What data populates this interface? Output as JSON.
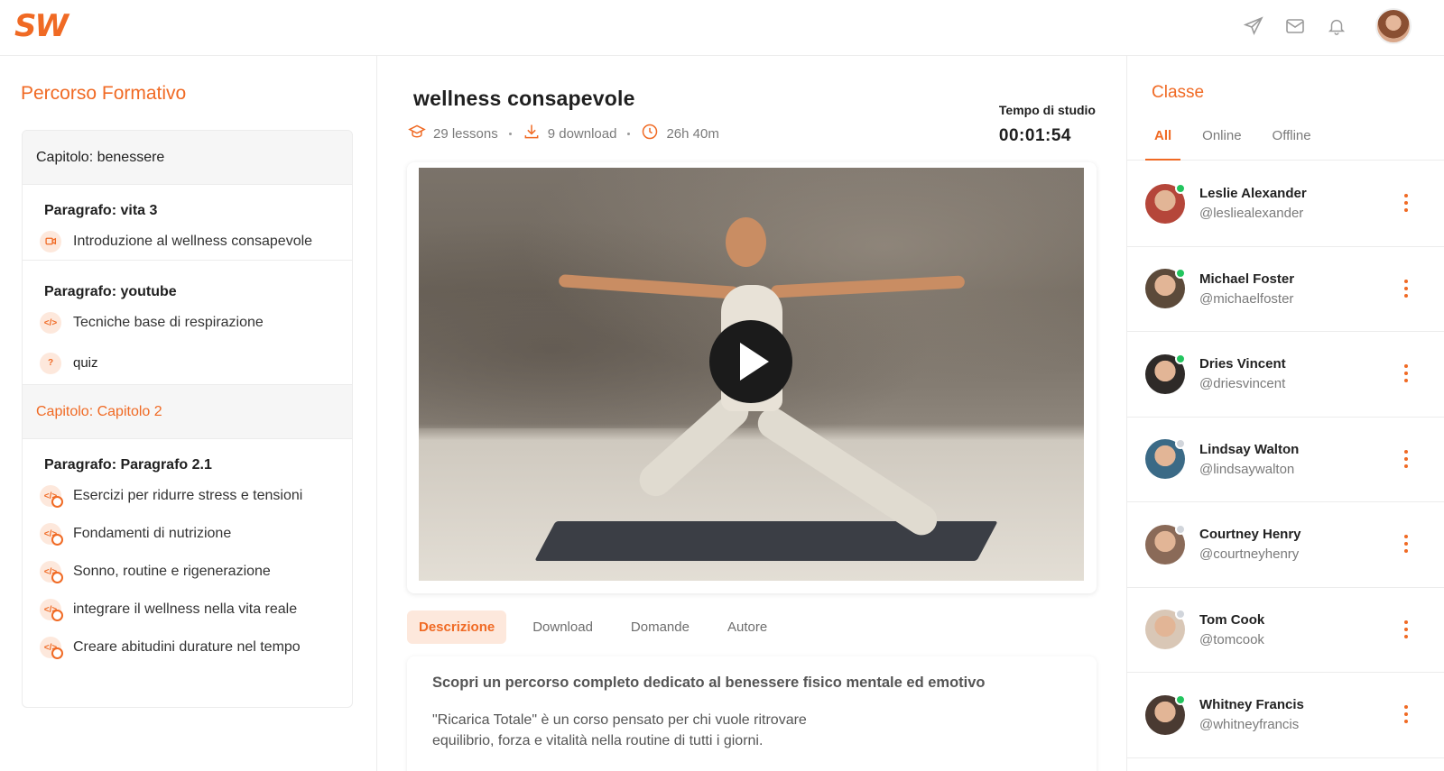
{
  "app": {
    "logo": "SW"
  },
  "header": {
    "icons": [
      "send-icon",
      "mail-icon",
      "bell-icon"
    ],
    "avatar": "user-avatar"
  },
  "sidebar": {
    "title": "Percorso Formativo",
    "chapter1": {
      "label": "Capitolo: benessere",
      "p1": {
        "label": "Paragrafo: vita 3",
        "lessons": [
          {
            "label": "Introduzione al wellness consapevole",
            "icon": "video-icon"
          }
        ]
      },
      "p2": {
        "label": "Paragrafo: youtube",
        "lessons": [
          {
            "label": "Tecniche base di respirazione",
            "icon": "code-icon"
          },
          {
            "label": "quiz",
            "icon": "question-icon"
          }
        ]
      }
    },
    "chapter2": {
      "label": "Capitolo: Capitolo 2",
      "p1": {
        "label": "Paragrafo: Paragrafo 2.1",
        "lessons": [
          {
            "label": "Esercizi per ridurre stress e tensioni"
          },
          {
            "label": "Fondamenti di nutrizione"
          },
          {
            "label": "Sonno, routine e rigenerazione"
          },
          {
            "label": "integrare il wellness nella vita reale"
          },
          {
            "label": "Creare abitudini durature nel tempo"
          }
        ]
      }
    }
  },
  "course": {
    "title": "wellness consapevole",
    "lessons": "29 lessons",
    "downloads": "9 download",
    "duration": "26h 40m",
    "study_label": "Tempo di studio",
    "study_time": "00:01:54"
  },
  "tabs": [
    "Descrizione",
    "Download",
    "Domande",
    "Autore"
  ],
  "description": {
    "heading": "Scopri un percorso completo dedicato al benessere fisico mentale ed emotivo",
    "body": "\"Ricarica Totale\" è un corso pensato per chi vuole ritrovare equilibrio, forza e vitalità nella routine di tutti i giorni."
  },
  "class": {
    "title": "Classe",
    "tabs": [
      "All",
      "Online",
      "Offline"
    ],
    "members": [
      {
        "name": "Leslie Alexander",
        "handle": "@lesliealexander",
        "online": true,
        "color": "#b5463a"
      },
      {
        "name": "Michael Foster",
        "handle": "@michaelfoster",
        "online": true,
        "color": "#5c4a3a"
      },
      {
        "name": "Dries Vincent",
        "handle": "@driesvincent",
        "online": true,
        "color": "#2e2a28"
      },
      {
        "name": "Lindsay Walton",
        "handle": "@lindsaywalton",
        "online": false,
        "color": "#3b6a86"
      },
      {
        "name": "Courtney Henry",
        "handle": "@courtneyhenry",
        "online": false,
        "color": "#8a6a58"
      },
      {
        "name": "Tom Cook",
        "handle": "@tomcook",
        "online": false,
        "color": "#d9c7b6"
      },
      {
        "name": "Whitney Francis",
        "handle": "@whitneyfrancis",
        "online": true,
        "color": "#4a3a32"
      }
    ]
  },
  "colors": {
    "accent": "#f06a24",
    "online": "#22c55e",
    "offline": "#d1d5db"
  }
}
